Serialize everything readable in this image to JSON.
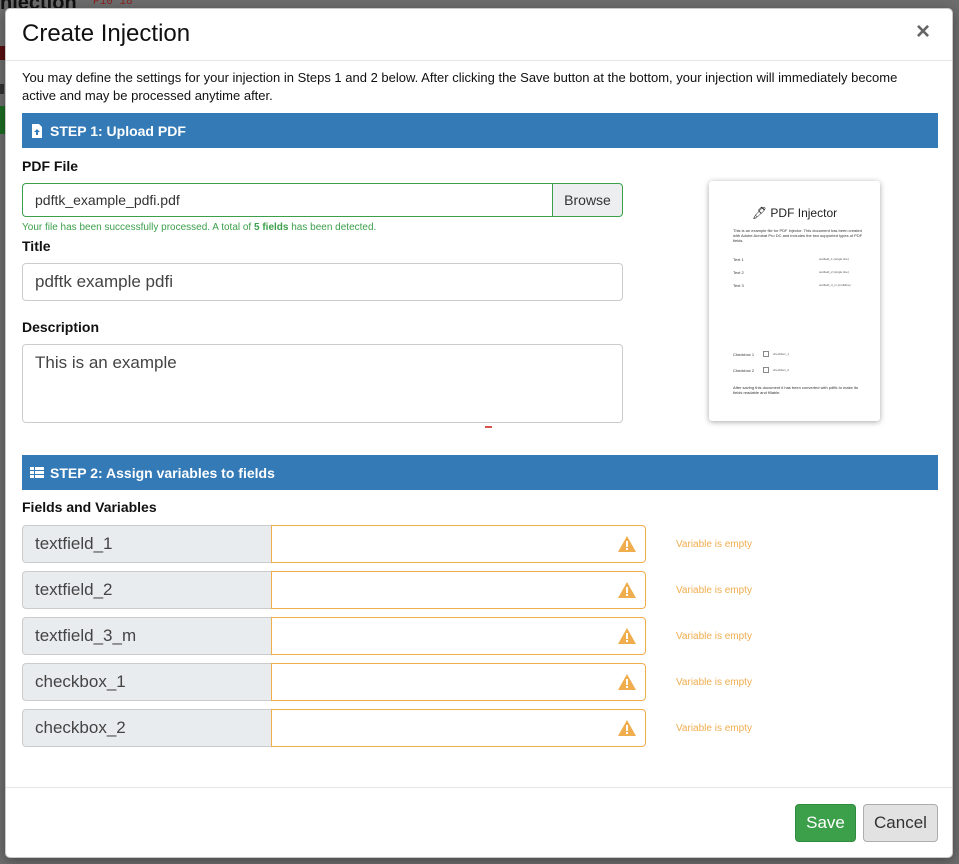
{
  "background": {
    "title": "njection",
    "code": "P10 18"
  },
  "modal": {
    "title": "Create Injection",
    "close_label": "×",
    "intro": "You may define the settings for your injection in Steps 1 and 2 below. After clicking the Save button at the bottom, your injection will immediately become active and may be processed anytime after."
  },
  "step1": {
    "header": "STEP 1: Upload PDF",
    "icon": "file-upload-icon",
    "pdf_label": "PDF File",
    "file_name": "pdftk_example_pdfi.pdf",
    "browse_label": "Browse",
    "help_prefix": "Your file has been successfully processed. A total of ",
    "help_count": "5 fields",
    "help_suffix": " has been detected.",
    "title_label": "Title",
    "title_value": "pdftk example pdfi",
    "description_label": "Description",
    "description_value": "This is an example"
  },
  "preview": {
    "title": "🖋 PDF Injector",
    "intro": "This is an example file for PDF Injector. This document has been created with Adobe Acrobat Pro DC and includes the two supported types of PDF fields.",
    "fields": [
      {
        "label": "Text 1",
        "value": "textfield_1 (single line)"
      },
      {
        "label": "Text 2",
        "value": "textfield_2 (single line)"
      },
      {
        "label": "Text 3",
        "value": "textfield_3_m (multiline)"
      }
    ],
    "checkboxes": [
      {
        "label": "Checkbox 1",
        "value": "checkbox_1"
      },
      {
        "label": "Checkbox 2",
        "value": "checkbox_2"
      }
    ],
    "footer": "After saving this document it has been converted with pdftk to make its fields readable and fillable."
  },
  "step2": {
    "header": "STEP 2: Assign variables to fields",
    "icon": "table-icon",
    "fields_label": "Fields and Variables",
    "rows": [
      {
        "field": "textfield_1",
        "variable": "",
        "help": "Variable is empty"
      },
      {
        "field": "textfield_2",
        "variable": "",
        "help": "Variable is empty"
      },
      {
        "field": "textfield_3_m",
        "variable": "",
        "help": "Variable is empty"
      },
      {
        "field": "checkbox_1",
        "variable": "",
        "help": "Variable is empty"
      },
      {
        "field": "checkbox_2",
        "variable": "",
        "help": "Variable is empty"
      }
    ]
  },
  "footer": {
    "save_label": "Save",
    "cancel_label": "Cancel"
  },
  "colors": {
    "primary": "#337ab7",
    "success": "#3ca04b",
    "warning": "#f0ad4e"
  }
}
